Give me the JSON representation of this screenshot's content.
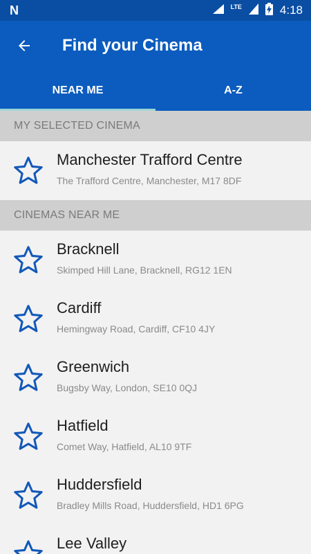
{
  "status_bar": {
    "time": "4:18",
    "network": "LTE"
  },
  "app_bar": {
    "title": "Find your Cinema"
  },
  "tabs": [
    {
      "label": "NEAR ME"
    },
    {
      "label": "A-Z"
    }
  ],
  "selected_section": {
    "header": "MY SELECTED CINEMA",
    "items": [
      {
        "name": "Manchester Trafford Centre",
        "address": "The Trafford Centre, Manchester, M17 8DF"
      }
    ]
  },
  "near_section": {
    "header": "CINEMAS NEAR ME",
    "items": [
      {
        "name": "Bracknell",
        "address": "Skimped Hill Lane, Bracknell, RG12 1EN"
      },
      {
        "name": "Cardiff",
        "address": "Hemingway Road, Cardiff, CF10 4JY"
      },
      {
        "name": "Greenwich",
        "address": "Bugsby Way, London, SE10 0QJ"
      },
      {
        "name": "Hatfield",
        "address": "Comet Way, Hatfield, AL10 9TF"
      },
      {
        "name": "Huddersfield",
        "address": "Bradley Mills Road, Huddersfield, HD1 6PG"
      },
      {
        "name": "Lee Valley",
        "address": ""
      }
    ]
  },
  "colors": {
    "primary": "#0b5cbe",
    "status_bar": "#0a4ea3",
    "tab_indicator": "#9fd7d4",
    "star": "#1258b8"
  }
}
